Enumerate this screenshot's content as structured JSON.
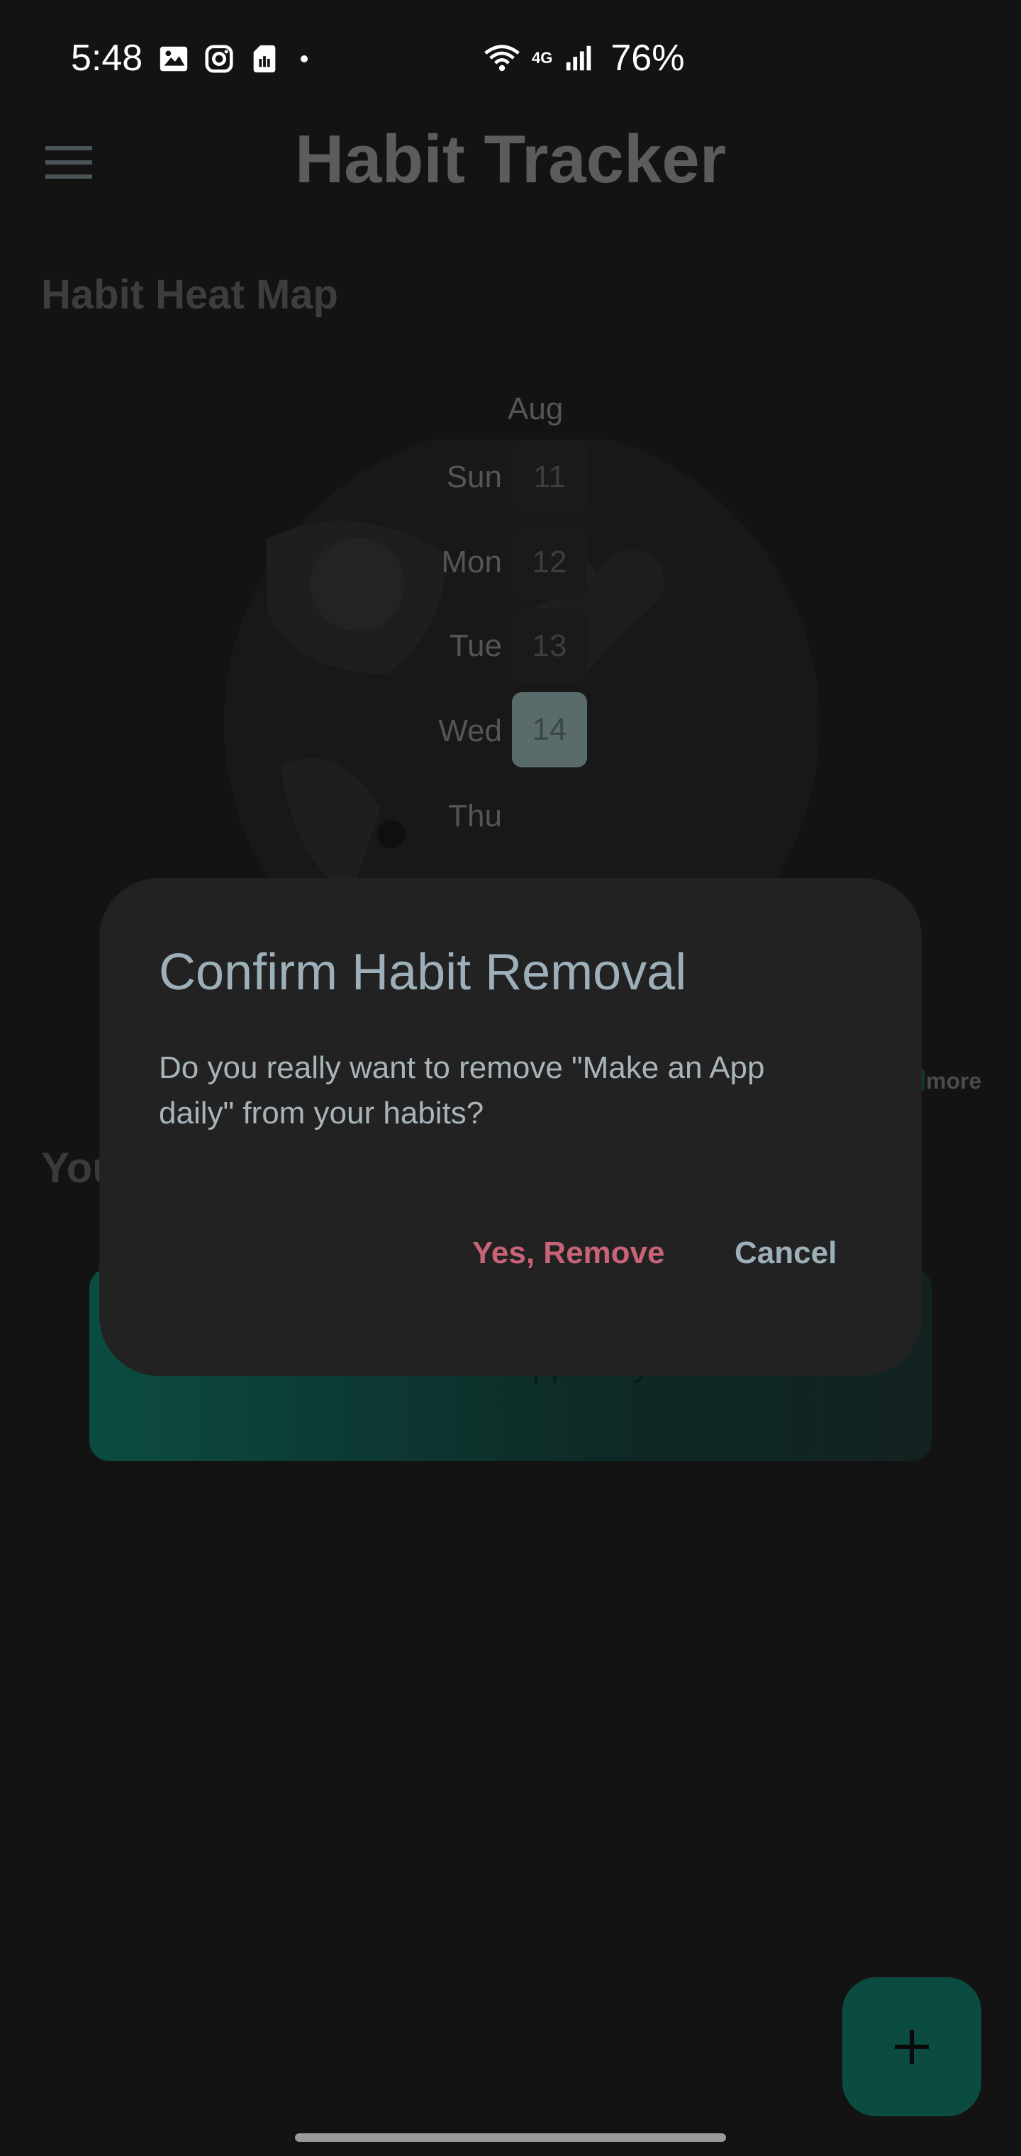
{
  "status_bar": {
    "time": "5:48",
    "network": "4G",
    "battery": "76%"
  },
  "app_bar": {
    "title": "Habit Tracker"
  },
  "heatmap": {
    "title": "Habit Heat Map",
    "month": "Aug",
    "days": [
      {
        "label": "Sun",
        "date": "11",
        "active": false
      },
      {
        "label": "Mon",
        "date": "12",
        "active": false
      },
      {
        "label": "Tue",
        "date": "13",
        "active": false
      },
      {
        "label": "Wed",
        "date": "14",
        "active": true
      },
      {
        "label": "Thu",
        "date": "",
        "active": false
      }
    ],
    "more_label": "more"
  },
  "habits_section": {
    "title_partial": "You",
    "card_text": "Make an App daily"
  },
  "dialog": {
    "title": "Confirm Habit Removal",
    "message": "Do you really want to remove \"Make an App daily\" from your habits?",
    "confirm_label": "Yes, Remove",
    "cancel_label": "Cancel"
  },
  "fab": {
    "icon": "plus-icon"
  },
  "colors": {
    "background": "#131313",
    "dialog": "#222222",
    "danger": "#c86378",
    "accent": "#0c4b40"
  }
}
